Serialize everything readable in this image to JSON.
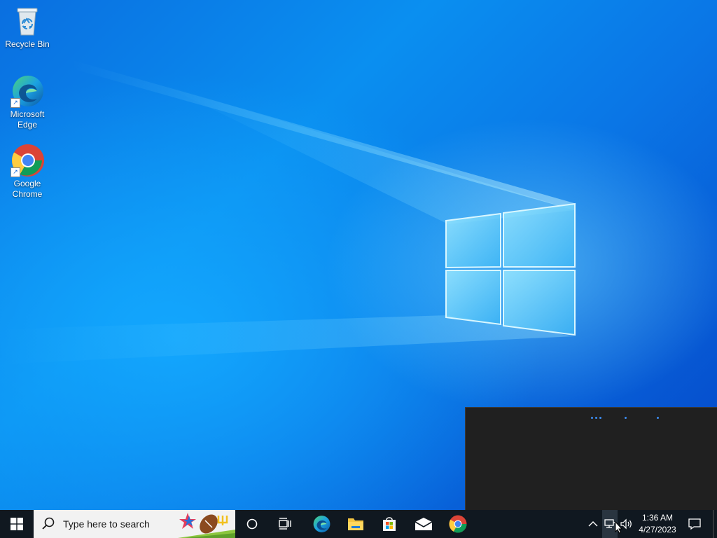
{
  "desktop": {
    "icons": [
      {
        "label": "Recycle Bin",
        "icon": "recycle-bin-icon"
      },
      {
        "label": "Microsoft Edge",
        "icon": "edge-icon"
      },
      {
        "label": "Google Chrome",
        "icon": "chrome-icon"
      }
    ]
  },
  "taskbar": {
    "search_placeholder": "Type here to search",
    "pinned": [
      {
        "name": "cortana",
        "icon": "circle-icon"
      },
      {
        "name": "task-view",
        "icon": "task-view-icon"
      },
      {
        "name": "edge",
        "icon": "edge-icon"
      },
      {
        "name": "file-explorer",
        "icon": "folder-icon"
      },
      {
        "name": "microsoft-store",
        "icon": "store-icon"
      },
      {
        "name": "mail",
        "icon": "mail-icon"
      },
      {
        "name": "chrome",
        "icon": "chrome-icon"
      }
    ],
    "tray": {
      "time": "1:36 AM",
      "date": "4/27/2023"
    }
  },
  "colors": {
    "taskbar": "#101820",
    "flyout": "#202020",
    "accent": "#3c8cf0"
  }
}
